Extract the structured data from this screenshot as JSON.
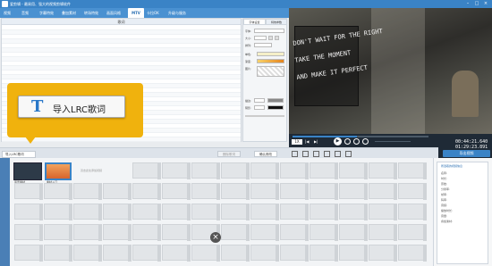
{
  "titlebar": {
    "logo_text": "爱剪辑",
    "title": "爱剪辑 - 最易用、强大的视频剪辑软件"
  },
  "menu": {
    "items": [
      "视频",
      "音频",
      "字幕特效",
      "叠加素材",
      "转场特效",
      "画面风格",
      "MTV",
      "卡拉OK",
      "升级与服务"
    ],
    "active": "MTV"
  },
  "lyric_panel": {
    "header": "歌词"
  },
  "callout": {
    "button_label": "导入LRC歌词"
  },
  "font_panel": {
    "tabs": [
      "字体设置",
      "特效参数"
    ],
    "labels": [
      "字体:",
      "大小:",
      "排列:",
      "单色:",
      "渐变:",
      "图片:",
      "描边:",
      "阴影:"
    ]
  },
  "preview": {
    "sign_lines": [
      "DON'T WAIT FOR THE RIGHT",
      "TAKE THE MOMENT",
      "AND MAKE IT PERFECT"
    ]
  },
  "controls": {
    "time_current": "00:44:21.640",
    "time_total": "01:29:23.891",
    "speed_label": "1X"
  },
  "timeline": {
    "tab_label": "导入LRC歌词",
    "delete_label": "删除歌词",
    "confirm_label": "确认修改",
    "export_label": "导出视频",
    "clip1": "风景素材",
    "clip2": "素材入门",
    "clip_hint": "双击此处添加视频"
  },
  "side": {
    "title": "所选取的视频信息",
    "lines": [
      "名称:",
      "时长:",
      "原始:",
      "分辨率:",
      "帧率:",
      "码率:",
      "音频:",
      "播放时长:",
      "音量:",
      "叠加素材:"
    ]
  },
  "colors": {
    "accent": "#3a83c6",
    "callout": "#f0b20d"
  }
}
